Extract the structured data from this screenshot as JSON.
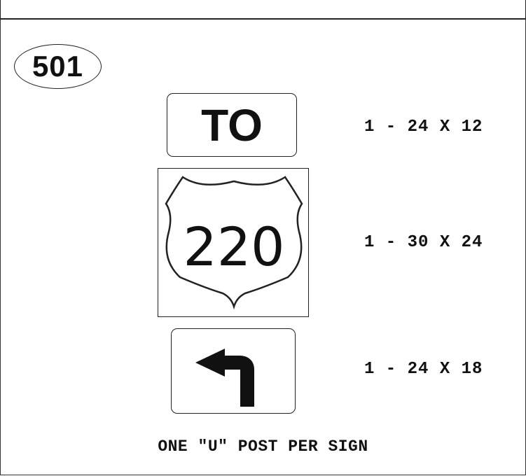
{
  "sheet": {
    "id_label": "501"
  },
  "signs": [
    {
      "legend": "TO",
      "size": "1 - 24 X 12"
    },
    {
      "legend": "220",
      "size": "1 - 30 X 24"
    },
    {
      "legend": "",
      "icon": "left-turn-arrow-icon",
      "size": "1 - 24 X 18"
    }
  ],
  "note": "ONE \"U\" POST PER SIGN",
  "colors": {
    "ink": "#111111",
    "background": "#ffffff"
  }
}
